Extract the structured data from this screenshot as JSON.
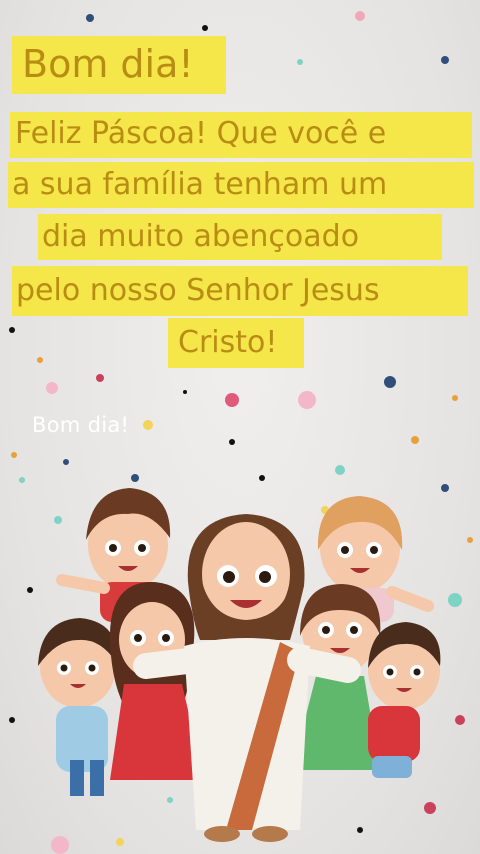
{
  "greeting": {
    "title": "Bom dia!",
    "lines": [
      "Feliz Páscoa! Que você e",
      "a sua família tenham um",
      "dia muito abençoado",
      "pelo nosso Senhor Jesus",
      "Cristo!"
    ]
  },
  "overlay": {
    "watermark": "Bom dia!"
  },
  "illustration": {
    "subject": "cartoon-jesus-with-children",
    "colors": {
      "highlight": "#f5e64a",
      "text": "#b98d14"
    }
  }
}
